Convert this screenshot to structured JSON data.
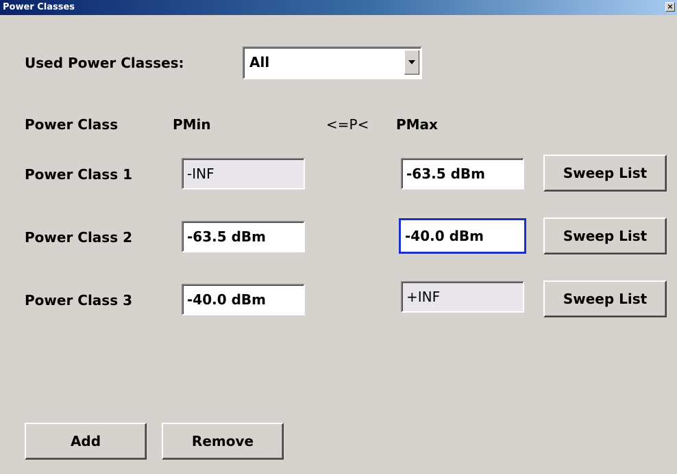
{
  "window": {
    "title": "Power Classes",
    "close_glyph": "×"
  },
  "used_power_classes": {
    "label": "Used Power Classes:",
    "selected": "All"
  },
  "headers": {
    "power_class": "Power Class",
    "pmin": "PMin",
    "condition": "<=P<",
    "pmax": "PMax"
  },
  "rows": [
    {
      "label": "Power Class 1",
      "pmin": "-INF",
      "pmax": "-63.5 dBm",
      "sweep_label": "Sweep List"
    },
    {
      "label": "Power Class 2",
      "pmin": "-63.5 dBm",
      "pmax": "-40.0 dBm",
      "sweep_label": "Sweep List"
    },
    {
      "label": "Power Class 3",
      "pmin": "-40.0 dBm",
      "pmax": "+INF",
      "sweep_label": "Sweep List"
    }
  ],
  "actions": {
    "add_label": "Add",
    "remove_label": "Remove"
  }
}
